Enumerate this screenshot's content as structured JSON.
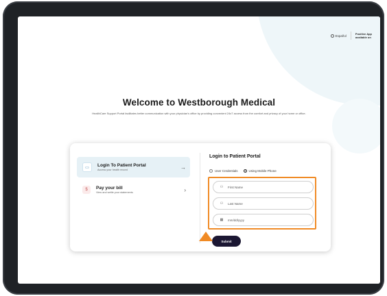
{
  "header": {
    "language_label": "Español",
    "app_note_line1": "Positive App",
    "app_note_line2": "available on"
  },
  "hero": {
    "title": "Welcome to Westborough Medical",
    "subtitle": "HealthCare Support Portal facilitates better communication with your physician's office by providing convenient 24x7 access from the comfort and privacy of your home or office."
  },
  "options": [
    {
      "title": "Login To Patient Portal",
      "description": "Access your health record",
      "arrow": "→"
    },
    {
      "title": "Pay your bill",
      "description": "View and settle your statements",
      "arrow": "›"
    }
  ],
  "form": {
    "title": "Login to Patient Portal",
    "radio_user_credentials": "User Credentials",
    "radio_mobile_phone": "Using Mobile Phone",
    "selected_radio": "Using Mobile Phone",
    "first_name_placeholder": "First Name",
    "last_name_placeholder": "Last Name",
    "dob_placeholder": "mm/dd/yyyy",
    "submit_label": "Submit"
  },
  "icons": {
    "portal": "id-card-icon",
    "bill": "dollar-icon",
    "first_name": "user-icon",
    "last_name": "user-icon",
    "dob": "calendar-icon",
    "language": "globe-icon"
  },
  "colors": {
    "highlight": "#f08a24",
    "submit_bg": "#1b1733",
    "active_option_bg": "#e6f1f6"
  }
}
